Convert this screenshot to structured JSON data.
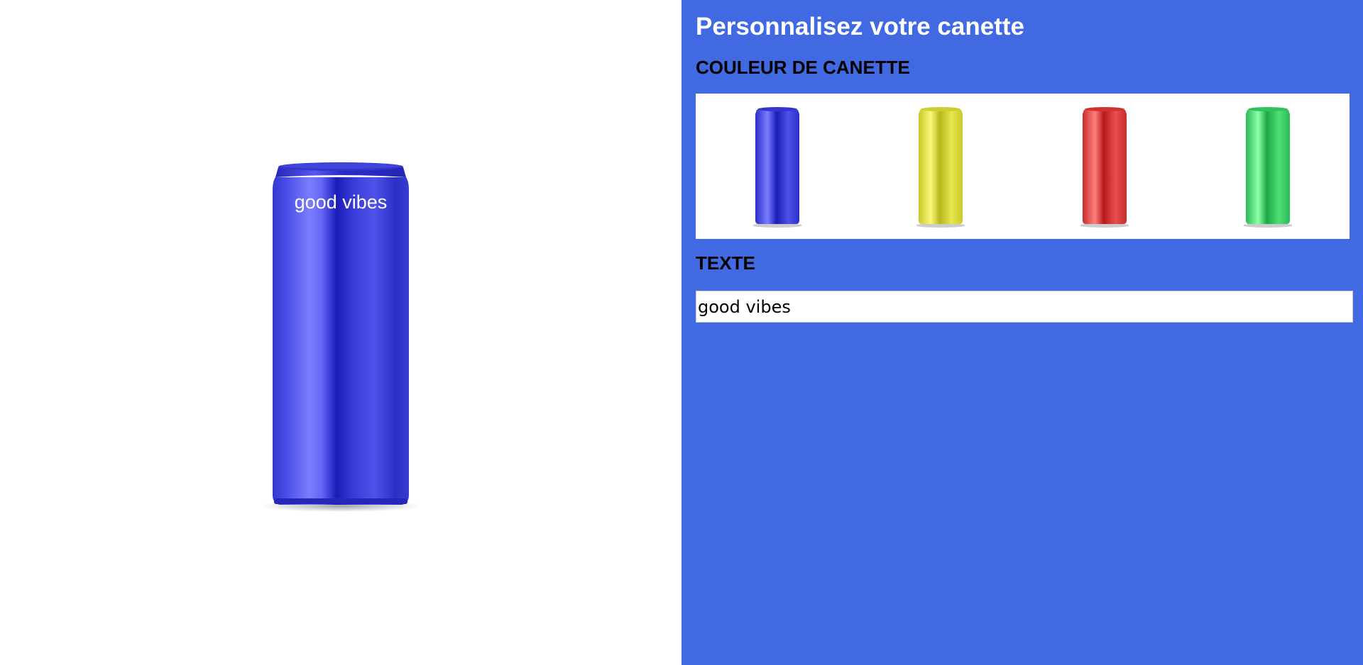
{
  "preview": {
    "can_color": "#2b2fd9",
    "can_text": "good vibes"
  },
  "panel": {
    "title": "Personnalisez votre canette",
    "color_section_label": "COULEUR DE CANETTE",
    "text_section_label": "TEXTE",
    "text_input_value": "good vibes",
    "background_color": "#4169e1"
  },
  "swatches": [
    {
      "name": "blue",
      "color": "#2b2fd9",
      "highlight": "#7b7dff"
    },
    {
      "name": "yellow",
      "color": "#d9d92b",
      "highlight": "#f8f87a"
    },
    {
      "name": "red",
      "color": "#d92b2b",
      "highlight": "#ff8080"
    },
    {
      "name": "green",
      "color": "#2bc95a",
      "highlight": "#8effa9"
    }
  ]
}
